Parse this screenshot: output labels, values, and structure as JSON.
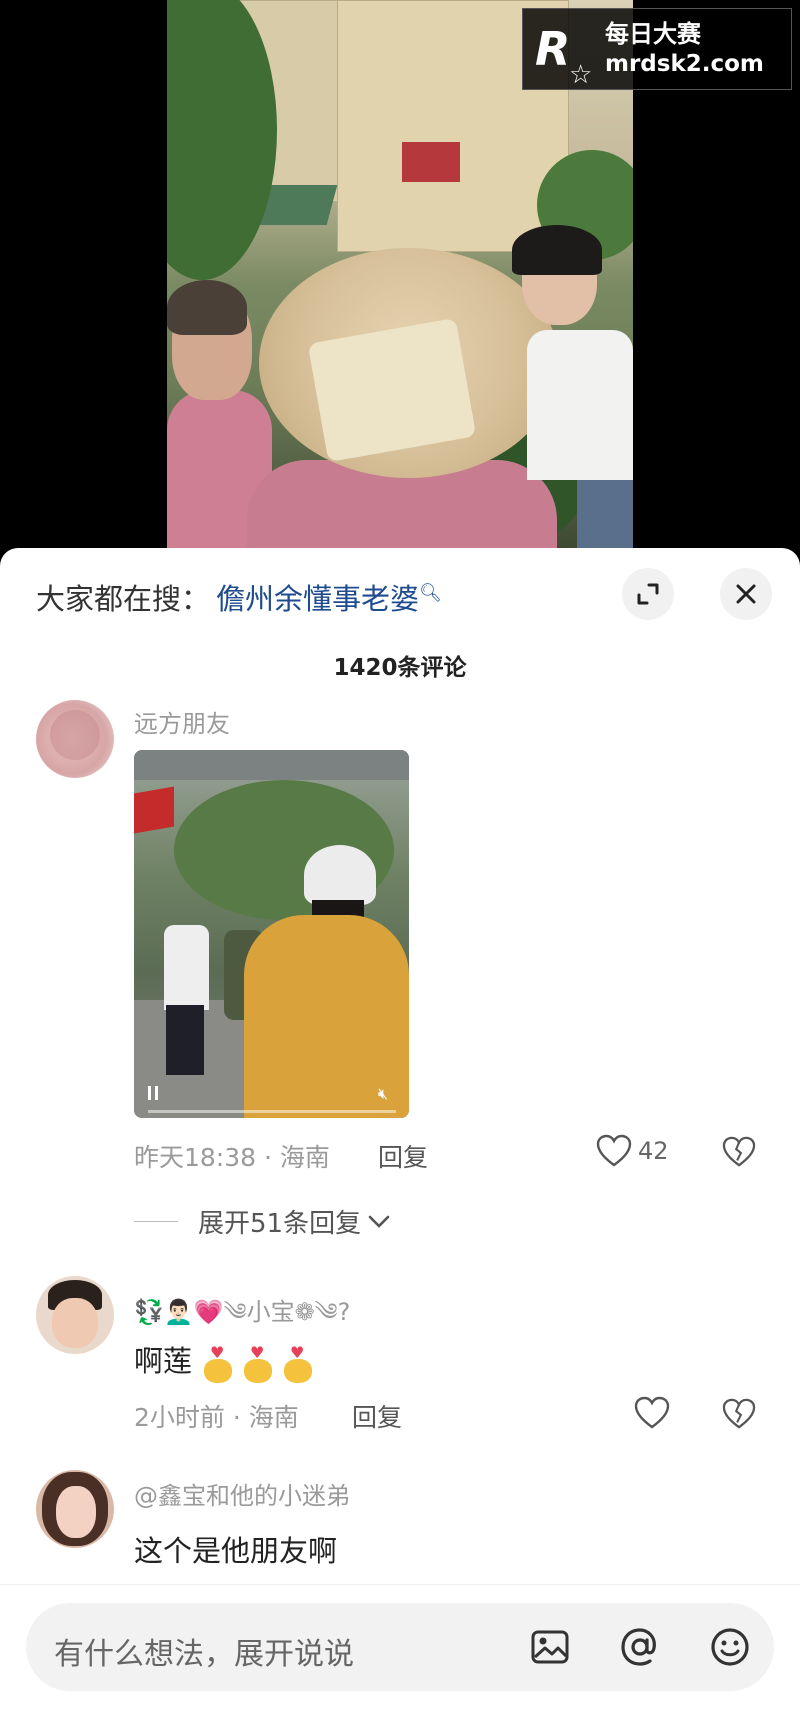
{
  "watermark": {
    "logo": "R",
    "line1": "每日大赛",
    "line2": "mrdsk2.com"
  },
  "search_bar": {
    "prefix": "大家都在搜：",
    "keyword": "儋州余懂事老婆"
  },
  "comment_count": "1420条评论",
  "comments": [
    {
      "username": "远方朋友",
      "meta": "昨天18:38 · 海南",
      "reply_label": "回复",
      "like_count": "42",
      "expand_label": "展开51条回复",
      "has_video": true
    },
    {
      "username": "💱👨🏻‍🦱💗༄小宝❁༄?",
      "text": "啊莲",
      "meta": "2小时前 · 海南",
      "reply_label": "回复"
    },
    {
      "username": "@鑫宝和他的小迷弟",
      "text": "这个是他朋友啊"
    }
  ],
  "input": {
    "placeholder": "有什么想法，展开说说"
  },
  "icons": {
    "expand": "expand-icon",
    "close": "close-icon",
    "like": "heart-icon",
    "dislike": "broken-heart-icon",
    "image": "image-icon",
    "mention": "at-icon",
    "emoji": "smiley-icon"
  }
}
